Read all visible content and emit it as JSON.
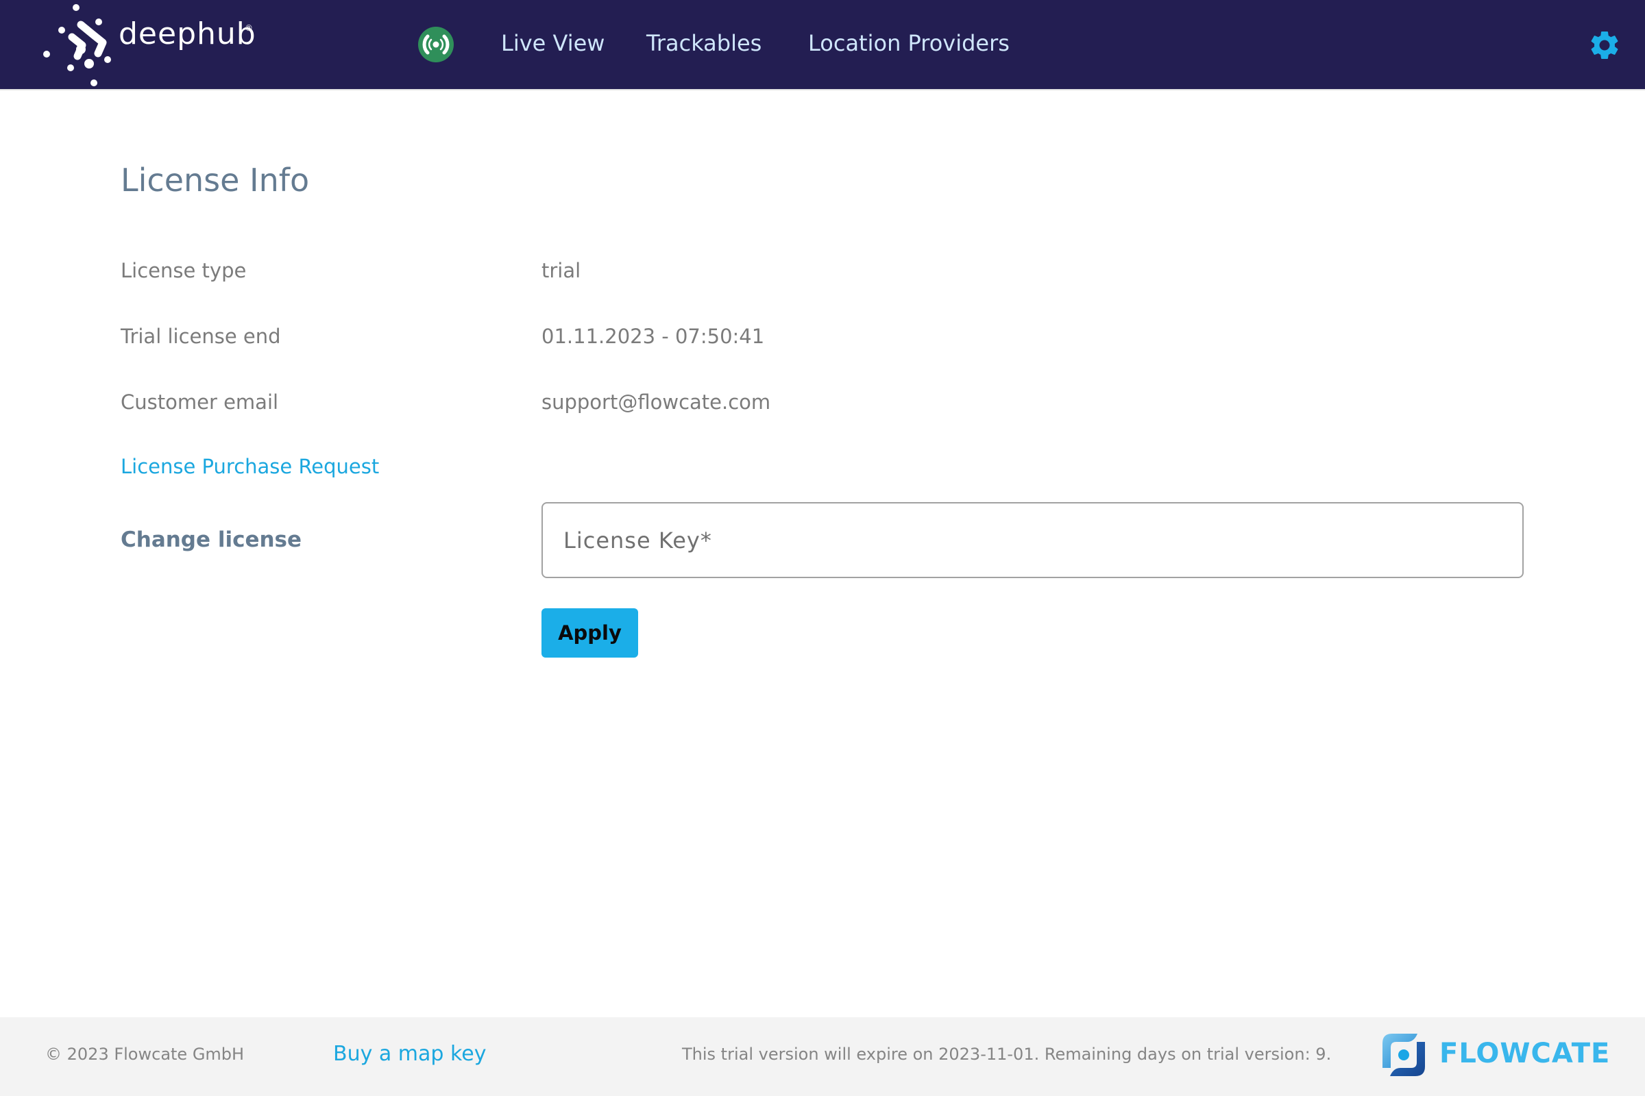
{
  "header": {
    "brand": "deephub",
    "brand_mark": "®",
    "live_status_icon": "live-broadcast-icon",
    "live_status_color": "#2f8f5a",
    "nav": [
      {
        "label": "Live View"
      },
      {
        "label": "Trackables"
      },
      {
        "label": "Location Providers"
      }
    ],
    "settings_icon": "gear-icon",
    "accent_color": "#1baee8",
    "background_color": "#231e52"
  },
  "main": {
    "title": "License Info",
    "rows": [
      {
        "label": "License type",
        "value": "trial"
      },
      {
        "label": "Trial license end",
        "value": "01.11.2023 - 07:50:41"
      },
      {
        "label": "Customer email",
        "value": "support@flowcate.com"
      }
    ],
    "purchase_link": "License Purchase Request",
    "change_license_label": "Change license",
    "license_key_input": {
      "placeholder": "License Key*",
      "value": ""
    },
    "apply_label": "Apply"
  },
  "footer": {
    "copyright": "© 2023 Flowcate GmbH",
    "buy_map_key": "Buy a map key",
    "trial_notice": "This trial version will expire on 2023-11-01. Remaining days on trial version: 9.",
    "company_logo_text": "FLOWCATE"
  }
}
